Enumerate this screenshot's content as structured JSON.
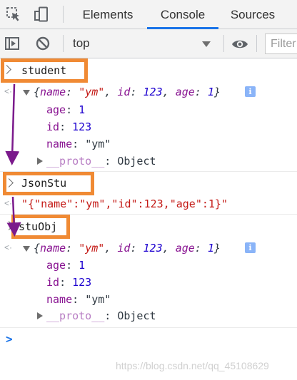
{
  "tabs": [
    "Elements",
    "Console",
    "Sources"
  ],
  "active_tab": "Console",
  "toolbar": {
    "context": "top",
    "filter_placeholder": "Filter"
  },
  "console": {
    "entry1": {
      "input": "student",
      "summary": {
        "open": "{",
        "k1": "name",
        "v1": "\"ym\"",
        "k2": "id",
        "v2": "123",
        "k3": "age",
        "v3": "1",
        "close": "}"
      },
      "props": [
        {
          "key": "age",
          "value": "1"
        },
        {
          "key": "id",
          "value": "123"
        },
        {
          "key": "name",
          "value": "\"ym\""
        }
      ],
      "proto_key": "__proto__",
      "proto_value": "Object"
    },
    "entry2": {
      "input": "JsonStu",
      "output": "\"{\"name\":\"ym\",\"id\":123,\"age\":1}\""
    },
    "entry3": {
      "input": "stuObj",
      "summary": {
        "open": "{",
        "k1": "name",
        "v1": "\"ym\"",
        "k2": "id",
        "v2": "123",
        "k3": "age",
        "v3": "1",
        "close": "}"
      },
      "props": [
        {
          "key": "age",
          "value": "1"
        },
        {
          "key": "id",
          "value": "123"
        },
        {
          "key": "name",
          "value": "\"ym\""
        }
      ],
      "proto_key": "__proto__",
      "proto_value": "Object"
    },
    "info_badge": "i"
  },
  "watermark": "https://blog.csdn.net/qq_45108629",
  "colors": {
    "highlight_box": "#f08a34",
    "arrow": "#7b1a8c",
    "active_tab_underline": "#1a73e8"
  },
  "icons": [
    "inspect-icon",
    "device-toggle-icon",
    "sidebar-toggle-icon",
    "clear-console-icon",
    "eye-icon"
  ]
}
